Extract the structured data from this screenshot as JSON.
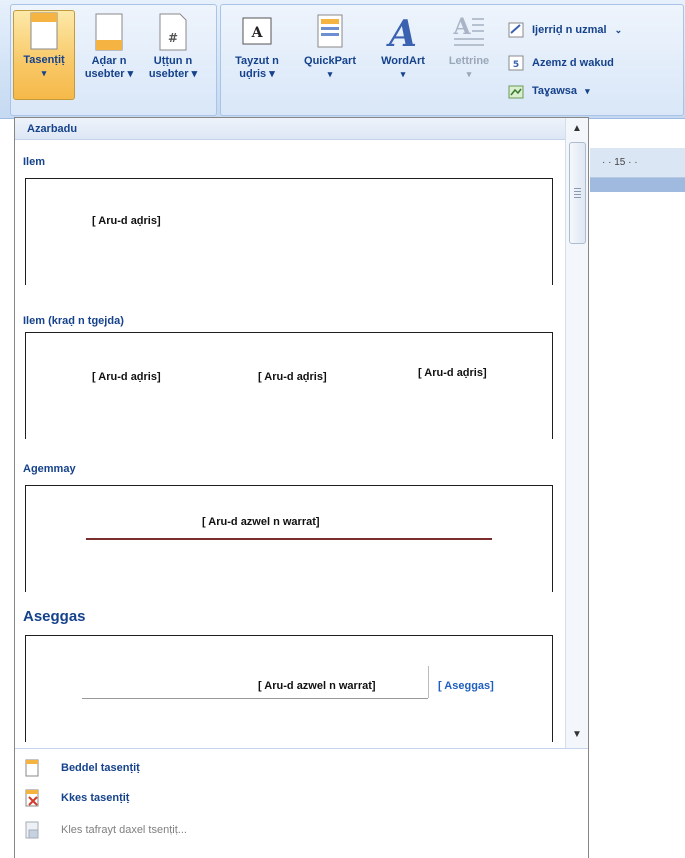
{
  "ribbon": {
    "buttons": [
      {
        "label1": "Tasenṭiṭ",
        "label2": "▾",
        "icon": "header-page-icon"
      },
      {
        "label1": "Aḍar n",
        "label2": "usebter ▾",
        "icon": "footer-page-icon"
      },
      {
        "label1": "Uṭṭun n",
        "label2": "usebter ▾",
        "icon": "page-number-icon"
      },
      {
        "label1": "Tayzut n",
        "label2": "uḍris ▾",
        "icon": "textbox-icon"
      },
      {
        "label1": "QuickPart",
        "label2": "▾",
        "icon": "quickpart-icon"
      },
      {
        "label1": "WordArt",
        "label2": "▾",
        "icon": "wordart-icon"
      },
      {
        "label1": "Lettrine",
        "label2": "▾",
        "icon": "dropcap-icon"
      }
    ],
    "small_commands": [
      {
        "label": "Ijerriḍ n uzmal",
        "icon": "signature-line-icon",
        "caret": "⌄"
      },
      {
        "label": "Azemz d wakud",
        "icon": "date-time-icon",
        "caret": ""
      },
      {
        "label": "Taɣawsa",
        "icon": "object-icon",
        "caret": "▾"
      }
    ]
  },
  "ruler": {
    "text": "·  ·  15  ·  ·"
  },
  "panel": {
    "title": "Azarbadu",
    "items": [
      {
        "label": "Ilem",
        "placeholders": [
          "[ Aru-d aḍris]"
        ]
      },
      {
        "label": "Ilem (kraḍ n tgejda)",
        "placeholders": [
          "[ Aru-d aḍris]",
          "[ Aru-d aḍris]",
          "[ Aru-d aḍris]"
        ]
      },
      {
        "label": "Agemmay",
        "placeholders": [
          "[ Aru-d azwel n warrat]"
        ]
      },
      {
        "label": "Aseggas",
        "placeholders": [
          "[ Aru-d azwel n warrat]",
          "[ Aseggas]"
        ]
      }
    ],
    "footer": {
      "edit": "Beddel tasenṭiṭ",
      "remove": "Kkes tasenṭiṭ",
      "save": "Kles tafrayt daxel tsenṭiṭ..."
    }
  }
}
